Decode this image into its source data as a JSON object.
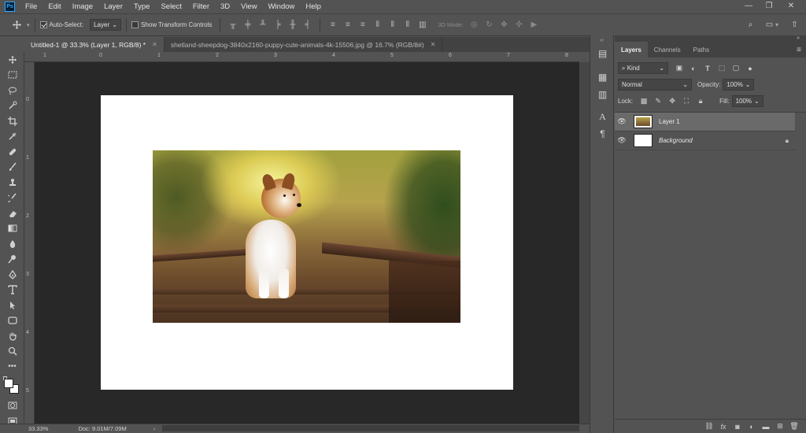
{
  "app": {
    "logo": "Ps"
  },
  "menu": [
    "File",
    "Edit",
    "Image",
    "Layer",
    "Type",
    "Select",
    "Filter",
    "3D",
    "View",
    "Window",
    "Help"
  ],
  "window_controls": {
    "minimize": "—",
    "restore": "❐",
    "close": "✕"
  },
  "options": {
    "auto_select_label": "Auto-Select:",
    "auto_select_checked": true,
    "auto_select_value": "Layer",
    "transform_label": "Show Transform Controls",
    "transform_checked": false,
    "mode_3d_label": "3D Mode:"
  },
  "tabs": [
    {
      "label": "Untitled-1 @ 33.3% (Layer 1, RGB/8) *",
      "active": true
    },
    {
      "label": "shetland-sheepdog-3840x2160-puppy-cute-animals-4k-15506.jpg @ 16.7% (RGB/8#)",
      "active": false
    }
  ],
  "ruler_top_marks": [
    "1",
    "0",
    "1",
    "2",
    "3",
    "4",
    "5",
    "6",
    "7",
    "8"
  ],
  "ruler_left_marks": [
    "0",
    "1",
    "2",
    "3",
    "4",
    "5"
  ],
  "layers_panel": {
    "tabs": [
      "Layers",
      "Channels",
      "Paths"
    ],
    "kind_label": "Kind",
    "blend_mode": "Normal",
    "opacity_label": "Opacity:",
    "opacity_value": "100%",
    "lock_label": "Lock:",
    "fill_label": "Fill:",
    "fill_value": "100%",
    "layers": [
      {
        "name": "Layer 1",
        "selected": true,
        "locked": false
      },
      {
        "name": "Background",
        "selected": false,
        "locked": true
      }
    ]
  },
  "status": {
    "zoom": "33.33%",
    "doc_info": "Doc: 9.01M/7.09M"
  },
  "colors": {
    "accent": "#31a8ff",
    "ui_bg": "#535353",
    "canvas_bg": "#282828"
  }
}
